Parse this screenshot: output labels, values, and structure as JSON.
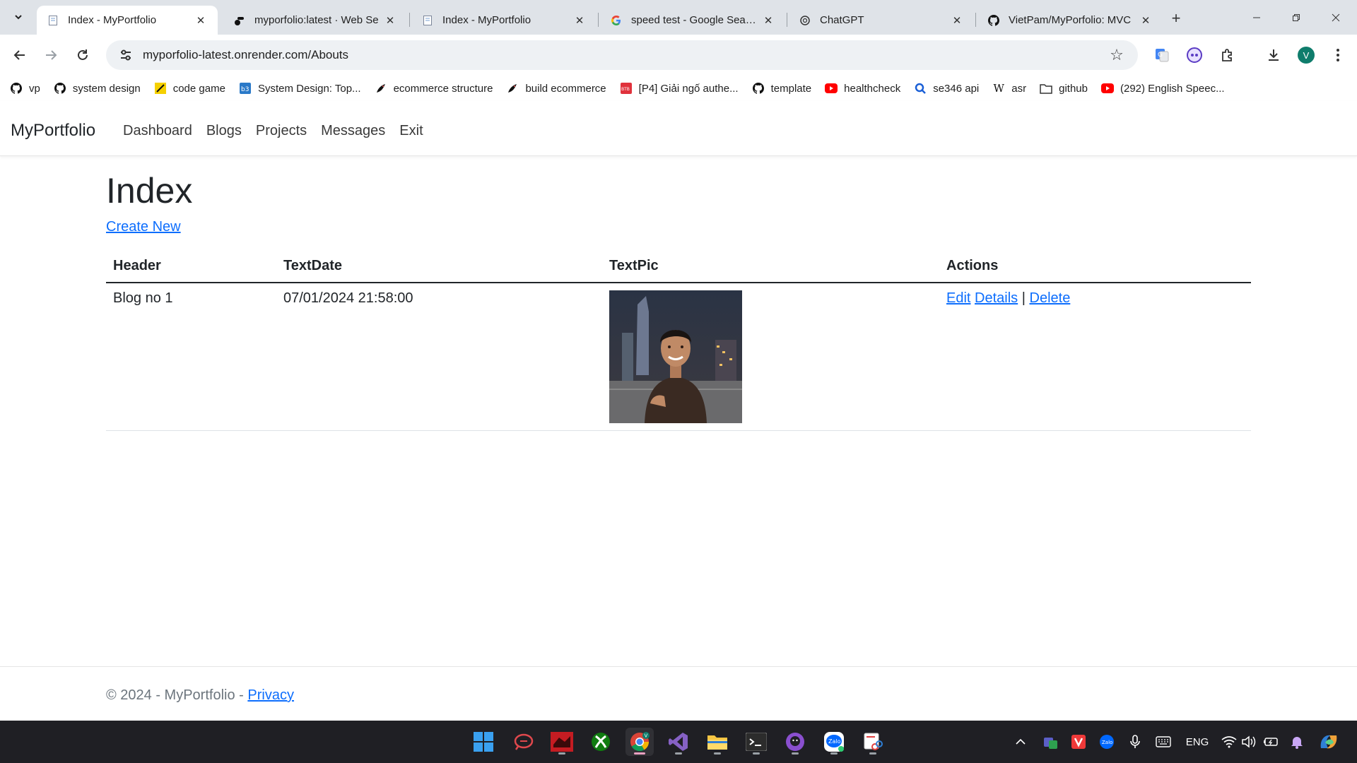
{
  "browser": {
    "tabs": [
      {
        "title": "Index - MyPortfolio",
        "icon": "page-icon",
        "active": true
      },
      {
        "title": "myporfolio:latest · Web Se",
        "icon": "render-icon",
        "active": false
      },
      {
        "title": "Index - MyPortfolio",
        "icon": "page-icon",
        "active": false
      },
      {
        "title": "speed test - Google Search",
        "icon": "google-icon",
        "active": false
      },
      {
        "title": "ChatGPT",
        "icon": "chatgpt-icon",
        "active": false
      },
      {
        "title": "VietPam/MyPorfolio: MVC",
        "icon": "github-icon",
        "active": false
      }
    ],
    "url": "myporfolio-latest.onrender.com/Abouts",
    "profile_initial": "V",
    "bookmarks": [
      {
        "label": "vp",
        "icon": "github-icon"
      },
      {
        "label": "system design",
        "icon": "github-icon"
      },
      {
        "label": "code game",
        "icon": "code-game-icon"
      },
      {
        "label": "System Design: Top...",
        "icon": "b3-icon"
      },
      {
        "label": "ecommerce structure",
        "icon": "bird-icon"
      },
      {
        "label": "build ecommerce",
        "icon": "bird-icon"
      },
      {
        "label": "[P4] Giải ngố authe...",
        "icon": "viblo-icon"
      },
      {
        "label": "template",
        "icon": "github-icon"
      },
      {
        "label": "healthcheck",
        "icon": "youtube-icon"
      },
      {
        "label": "se346 api",
        "icon": "search-icon"
      },
      {
        "label": "asr",
        "icon": "wikipedia-icon"
      },
      {
        "label": "github",
        "icon": "folder-icon"
      },
      {
        "label": "(292) English Speec...",
        "icon": "youtube-icon"
      }
    ]
  },
  "app": {
    "brand": "MyPortfolio",
    "nav": [
      "Dashboard",
      "Blogs",
      "Projects",
      "Messages",
      "Exit"
    ],
    "heading": "Index",
    "create_link": "Create New",
    "table": {
      "columns": [
        "Header",
        "TextDate",
        "TextPic",
        "Actions"
      ],
      "rows": [
        {
          "header": "Blog no 1",
          "date": "07/01/2024 21:58:00",
          "pic": "portrait-photo",
          "actions": {
            "edit": "Edit",
            "details": "Details",
            "sep": "|",
            "delete": "Delete"
          }
        }
      ]
    },
    "footer": {
      "text": "© 2024 - MyPortfolio - ",
      "privacy": "Privacy"
    }
  },
  "taskbar": {
    "apps": [
      "windows-start",
      "chat-app",
      "game-app",
      "xbox",
      "chrome",
      "visual-studio",
      "file-explorer",
      "terminal",
      "github-desktop",
      "zalo",
      "snipping-tool"
    ],
    "tray": {
      "language": "ENG"
    }
  },
  "colors": {
    "link": "#0d6efd",
    "tabstrip": "#dfe3e8",
    "taskbar": "#1f1f24"
  }
}
